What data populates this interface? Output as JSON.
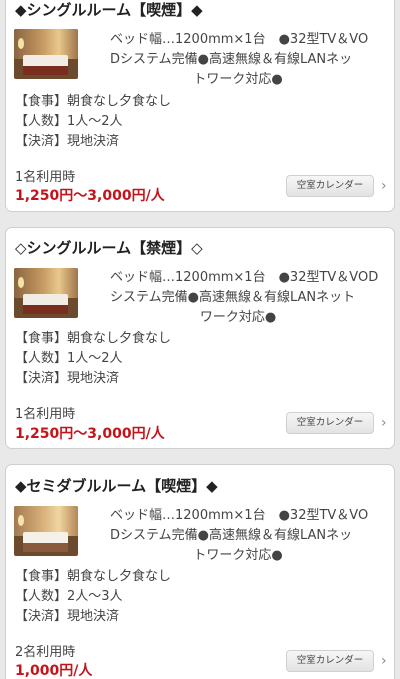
{
  "rooms": [
    {
      "title": "◆シングルルーム【喫煙】◆",
      "desc_lines": [
        "ベッド幅…1200mm×1台　●32型TV＆VO",
        "Dシステム完備●高速無線＆有線LANネッ",
        "トワーク対応●"
      ],
      "meal": "【食事】朝食なし夕食なし",
      "people": "【人数】1人～2人",
      "payment": "【決済】現地決済",
      "usage": "1名利用時",
      "price": "1,250円～3,000円/人",
      "calendar_label": "空室カレンダー"
    },
    {
      "title": "◇シングルルーム【禁煙】◇",
      "desc_lines": [
        "ベッド幅…1200mm×1台　●32型TV＆VOD",
        "システム完備●高速無線＆有線LANネット",
        "ワーク対応●"
      ],
      "meal": "【食事】朝食なし夕食なし",
      "people": "【人数】1人～2人",
      "payment": "【決済】現地決済",
      "usage": "1名利用時",
      "price": "1,250円～3,000円/人",
      "calendar_label": "空室カレンダー"
    },
    {
      "title": "◆セミダブルルーム【喫煙】◆",
      "desc_lines": [
        "ベッド幅…1200mm×1台　●32型TV＆VO",
        "Dシステム完備●高速無線＆有線LANネッ",
        "トワーク対応●"
      ],
      "meal": "【食事】朝食なし夕食なし",
      "people": "【人数】2人～3人",
      "payment": "【決済】現地決済",
      "usage": "2名利用時",
      "price": "1,000円/人",
      "calendar_label": "空室カレンダー"
    }
  ],
  "icons": {
    "room_photo": "room-photo",
    "chevron": "chevron-right-icon"
  },
  "colors": {
    "price": "#c4141b",
    "background": "#e9e9e9"
  }
}
